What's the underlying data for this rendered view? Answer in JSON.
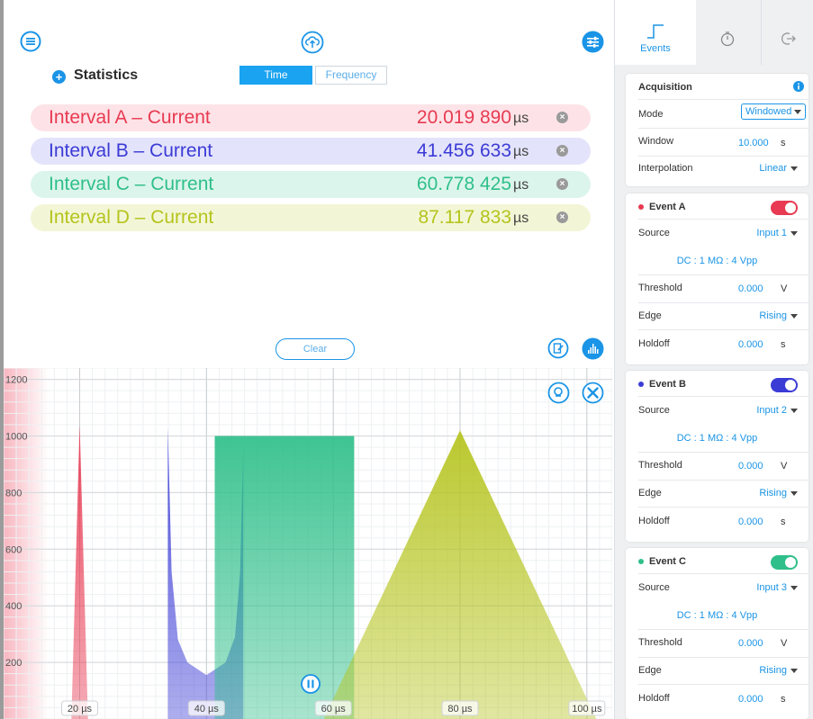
{
  "toolbar": {
    "menu_icon": "hamburger-menu-icon",
    "upload_icon": "cloud-upload-icon",
    "settings_icon": "sliders-icon"
  },
  "statistics": {
    "title": "Statistics",
    "tabs": [
      {
        "label": "Time",
        "active": true
      },
      {
        "label": "Frequency",
        "active": false
      }
    ],
    "rows": [
      {
        "label": "Interval A – Current",
        "value": "20.019 890",
        "unit": "µs",
        "color": "#e83a52",
        "bg": "#fde3e7"
      },
      {
        "label": "Interval B – Current",
        "value": "41.456 633",
        "unit": "µs",
        "color": "#3b3bd6",
        "bg": "#e3e3fb"
      },
      {
        "label": "Interval C – Current",
        "value": "60.778 425",
        "unit": "µs",
        "color": "#2fbf8a",
        "bg": "#dcf5ec"
      },
      {
        "label": "Interval D – Current",
        "value": "87.117 833",
        "unit": "µs",
        "color": "#b5c41d",
        "bg": "#f3f6d6"
      }
    ],
    "clear_label": "Clear"
  },
  "chart_data": {
    "type": "area",
    "yticks": [
      200,
      400,
      600,
      800,
      1000,
      1200
    ],
    "xticks": [
      "20 µs",
      "40 µs",
      "60 µs",
      "80 µs",
      "100 µs"
    ],
    "xtick_values": [
      20,
      40,
      60,
      80,
      100
    ],
    "xlim": [
      8,
      104
    ],
    "ylim": [
      0,
      1240
    ],
    "grid": true,
    "series": [
      {
        "color": "#e83a52",
        "points": [
          [
            18.7,
            0
          ],
          [
            20.0,
            1040
          ],
          [
            21.3,
            0
          ]
        ]
      },
      {
        "color": "#3b3bd6",
        "points": [
          [
            33.9,
            0
          ],
          [
            33.9,
            1030
          ],
          [
            34.5,
            520
          ],
          [
            35.5,
            280
          ],
          [
            37,
            200
          ],
          [
            40,
            155
          ],
          [
            43,
            200
          ],
          [
            44.5,
            290
          ],
          [
            45.3,
            520
          ],
          [
            45.8,
            960
          ],
          [
            45.8,
            0
          ]
        ]
      },
      {
        "color": "#2fbf8a",
        "points": [
          [
            41.3,
            0
          ],
          [
            41.3,
            1000
          ],
          [
            63.3,
            1000
          ],
          [
            63.3,
            0
          ]
        ]
      },
      {
        "color": "#b5c41d",
        "points": [
          [
            58.5,
            0
          ],
          [
            80.0,
            1020
          ],
          [
            101.5,
            0
          ]
        ]
      }
    ]
  },
  "tabs": [
    {
      "label": "Events",
      "icon": "step-edge-icon"
    },
    {
      "label": "",
      "icon": "stopwatch-icon"
    },
    {
      "label": "",
      "icon": "exit-arrow-icon"
    }
  ],
  "acquisition": {
    "title": "Acquisition",
    "mode_label": "Mode",
    "mode_value": "Windowed",
    "window_label": "Window",
    "window_value": "10.000",
    "window_unit": "s",
    "interp_label": "Interpolation",
    "interp_value": "Linear"
  },
  "events": [
    {
      "name": "Event A",
      "color": "#e83a52",
      "source": "Input 1",
      "coupling": "DC : 1 MΩ : 4 Vpp",
      "threshold": "0.000",
      "threshold_unit": "V",
      "edge": "Rising",
      "holdoff": "0.000",
      "holdoff_unit": "s"
    },
    {
      "name": "Event B",
      "color": "#3b3bd6",
      "source": "Input 2",
      "coupling": "DC : 1 MΩ : 4 Vpp",
      "threshold": "0.000",
      "threshold_unit": "V",
      "edge": "Rising",
      "holdoff": "0.000",
      "holdoff_unit": "s"
    },
    {
      "name": "Event C",
      "color": "#2fbf8a",
      "source": "Input 3",
      "coupling": "DC : 1 MΩ : 4 Vpp",
      "threshold": "0.000",
      "threshold_unit": "V",
      "edge": "Rising",
      "holdoff": "0.000",
      "holdoff_unit": "s"
    }
  ],
  "labels": {
    "source": "Source",
    "threshold": "Threshold",
    "edge": "Edge",
    "holdoff": "Holdoff"
  }
}
